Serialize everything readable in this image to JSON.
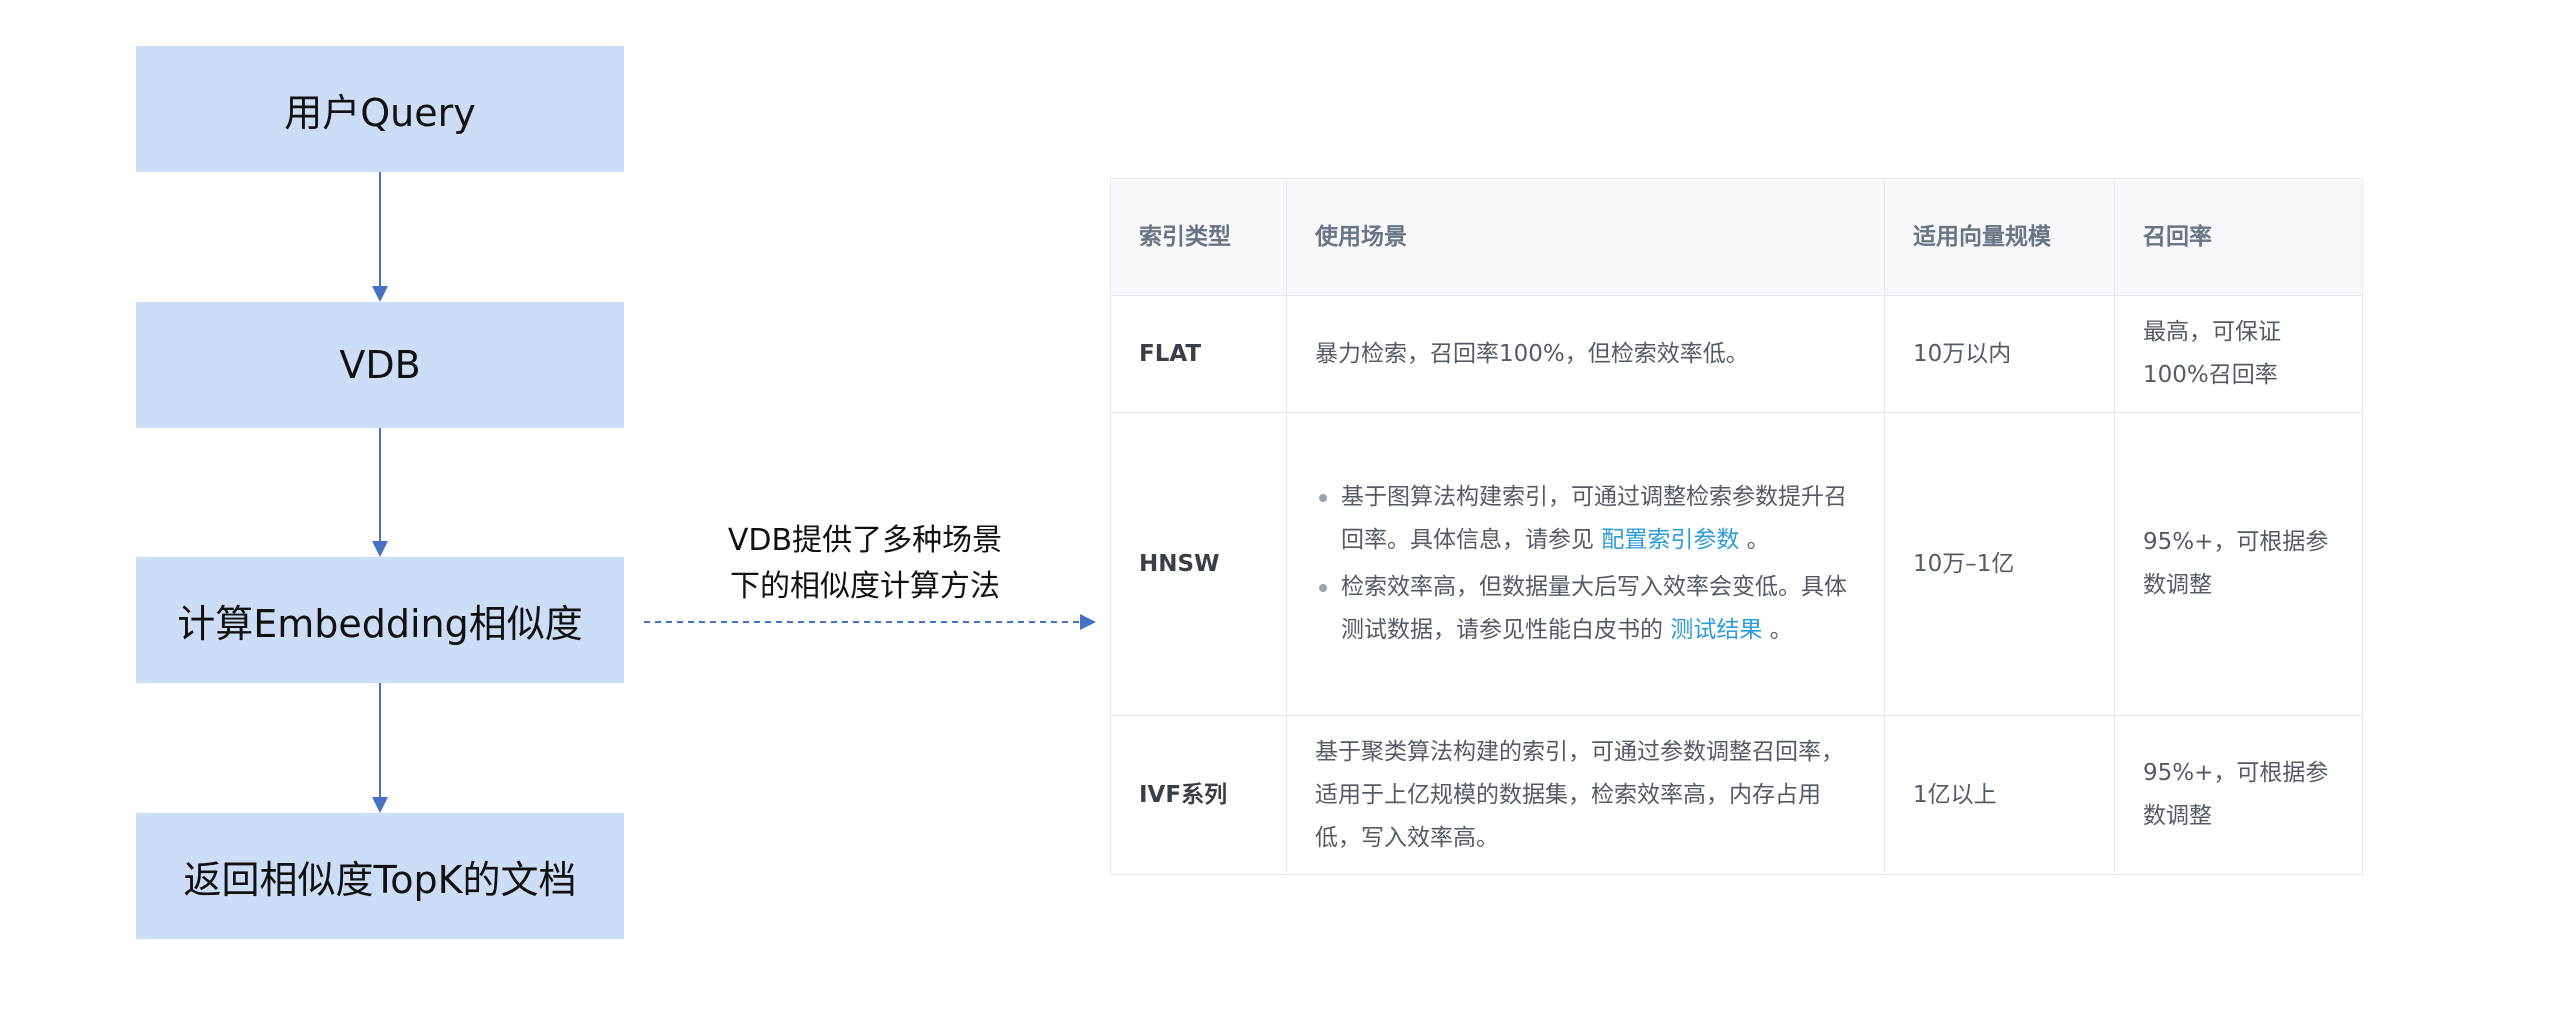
{
  "flow": {
    "steps": [
      "用户Query",
      "VDB",
      "计算Embedding相似度",
      "返回相似度TopK的文档"
    ],
    "box_color": "#cddcf7",
    "arrow_color": "#4472c4"
  },
  "annotation": {
    "line1": "VDB提供了多种场景",
    "line2": "下的相似度计算方法"
  },
  "table": {
    "headers": [
      "索引类型",
      "使用场景",
      "适用向量规模",
      "召回率"
    ],
    "rows": [
      {
        "type": "FLAT",
        "scenario": "暴力检索，召回率100%，但检索效率低。",
        "scale": "10万以内",
        "recall": "最高，可保证100%召回率"
      },
      {
        "type": "HNSW",
        "bullets": [
          {
            "text": "基于图算法构建索引，可通过调整检索参数提升召回率。具体信息，请参见 ",
            "link": "配置索引参数",
            "suffix": " 。"
          },
          {
            "text": "检索效率高，但数据量大后写入效率会变低。具体测试数据，请参见性能白皮书的 ",
            "link": "测试结果",
            "suffix": " 。"
          }
        ],
        "scale": "10万–1亿",
        "recall": "95%+，可根据参数调整"
      },
      {
        "type": "IVF系列",
        "scenario": "基于聚类算法构建的索引，可通过参数调整召回率，适用于上亿规模的数据集，检索效率高，内存占用低，写入效率高。",
        "scale": "1亿以上",
        "recall": "95%+，可根据参数调整"
      }
    ],
    "link_color": "#2e9bd6"
  }
}
